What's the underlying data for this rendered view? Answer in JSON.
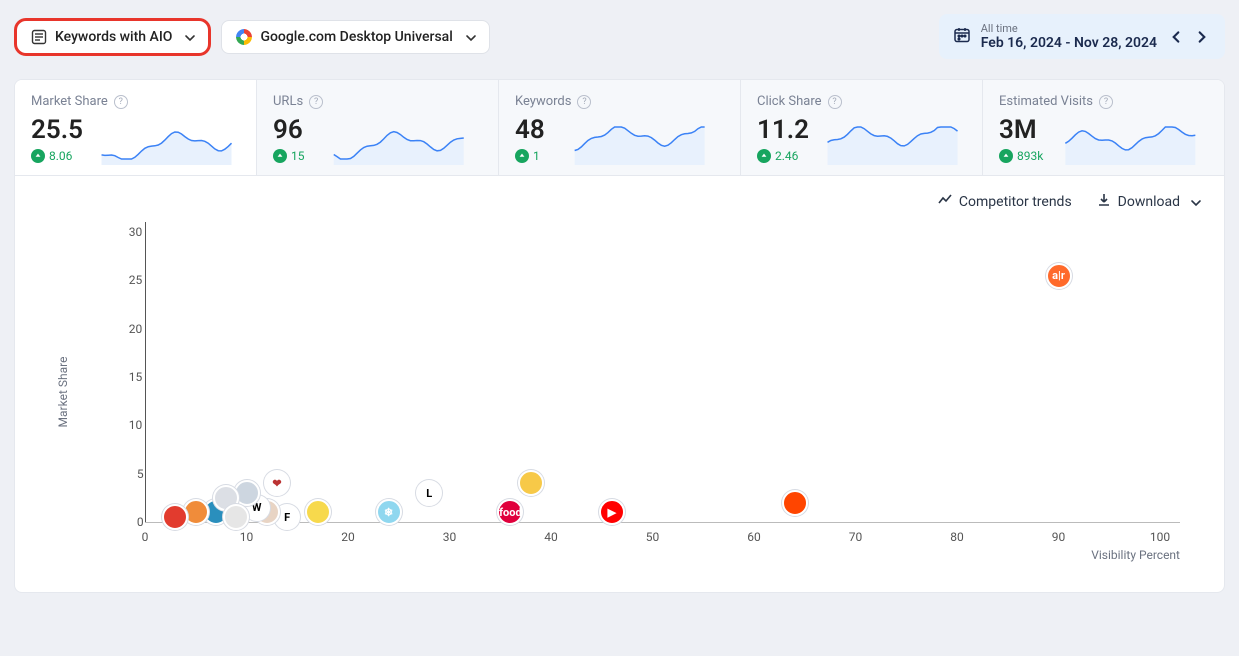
{
  "topbar": {
    "keyword_filter_label": "Keywords with AIO",
    "engine_label": "Google.com Desktop Universal"
  },
  "date": {
    "scope_label": "All time",
    "range": "Feb 16, 2024 - Nov 28, 2024"
  },
  "cards": [
    {
      "title": "Market Share",
      "value": "25.5",
      "change": "8.06"
    },
    {
      "title": "URLs",
      "value": "96",
      "change": "15"
    },
    {
      "title": "Keywords",
      "value": "48",
      "change": "1"
    },
    {
      "title": "Click Share",
      "value": "11.2",
      "change": "2.46"
    },
    {
      "title": "Estimated Visits",
      "value": "3M",
      "change": "893k"
    }
  ],
  "panel": {
    "competitor_trends_label": "Competitor trends",
    "download_label": "Download"
  },
  "chart_data": {
    "type": "scatter",
    "title": "",
    "xlabel": "Visibility Percent",
    "ylabel": "Market Share",
    "xlim": [
      0,
      100
    ],
    "ylim": [
      0,
      30
    ],
    "x_ticks": [
      0,
      10,
      20,
      30,
      40,
      50,
      60,
      70,
      80,
      90,
      100
    ],
    "y_ticks": [
      0,
      5,
      10,
      15,
      20,
      25,
      30
    ],
    "points": [
      {
        "name": "allrecipes",
        "x": 90,
        "y": 25.5,
        "color": "#ff6a2b",
        "label": "a|r"
      },
      {
        "name": "reddit",
        "x": 64,
        "y": 2,
        "color": "#ff4500",
        "label": ""
      },
      {
        "name": "youtube",
        "x": 46,
        "y": 1,
        "color": "#ff0000",
        "label": "▶"
      },
      {
        "name": "foodnetwork",
        "x": 36,
        "y": 1,
        "color": "#e0003c",
        "label": "food"
      },
      {
        "name": "site-yellow",
        "x": 38,
        "y": 4,
        "color": "#f7c948",
        "label": ""
      },
      {
        "name": "site-L",
        "x": 28,
        "y": 3,
        "color": "#ffffff",
        "label": "L",
        "textcolor": "#000"
      },
      {
        "name": "site-snow",
        "x": 24,
        "y": 1,
        "color": "#8fd7ef",
        "label": "❄"
      },
      {
        "name": "site-lemon",
        "x": 17,
        "y": 1,
        "color": "#f7d94c",
        "label": ""
      },
      {
        "name": "site-F",
        "x": 14,
        "y": 0.5,
        "color": "#ffffff",
        "label": "F",
        "textcolor": "#000"
      },
      {
        "name": "site-avatar",
        "x": 12,
        "y": 1,
        "color": "#e8d4c4",
        "label": ""
      },
      {
        "name": "site-W",
        "x": 11,
        "y": 1.5,
        "color": "#ffffff",
        "label": "W",
        "textcolor": "#000"
      },
      {
        "name": "site-heart",
        "x": 13,
        "y": 4,
        "color": "#ffffff",
        "label": "❤",
        "textcolor": "#b33"
      },
      {
        "name": "site-swirl",
        "x": 10,
        "y": 3,
        "color": "#cdd6e0",
        "label": ""
      },
      {
        "name": "site-pot",
        "x": 7,
        "y": 1,
        "color": "#2a8fbd",
        "label": ""
      },
      {
        "name": "site-orange",
        "x": 5,
        "y": 1,
        "color": "#f08c3a",
        "label": ""
      },
      {
        "name": "site-spoon",
        "x": 3,
        "y": 0.5,
        "color": "#e23b2e",
        "label": ""
      },
      {
        "name": "site-gray1",
        "x": 8,
        "y": 2.5,
        "color": "#dcdfe5",
        "label": ""
      },
      {
        "name": "site-gray2",
        "x": 9,
        "y": 0.5,
        "color": "#e6e6e6",
        "label": ""
      }
    ]
  }
}
